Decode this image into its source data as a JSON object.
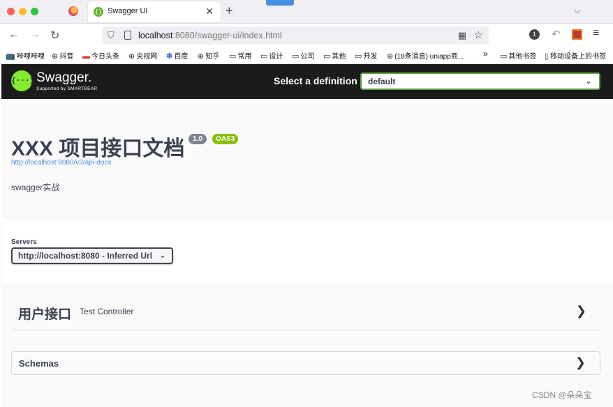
{
  "browser": {
    "tab_title": "Swagger UI",
    "tab_close": "✕",
    "new_tab": "+",
    "tab_list": "⌵",
    "url_host": "localhost",
    "url_path": ":8080/swagger-ui/index.html",
    "nav": {
      "back": "←",
      "forward": "→",
      "reload": "↻"
    },
    "badge_count": "1",
    "menu": "≡",
    "bookmarks": [
      {
        "icon": "tv-icon",
        "label": "哔哩哔哩"
      },
      {
        "icon": "globe-icon",
        "label": "抖音"
      },
      {
        "icon": "news-icon",
        "label": "今日头条"
      },
      {
        "icon": "globe-icon",
        "label": "央视网"
      },
      {
        "icon": "paw-icon",
        "label": "百度"
      },
      {
        "icon": "globe-icon",
        "label": "知乎"
      },
      {
        "icon": "folder-icon",
        "label": "常用"
      },
      {
        "icon": "folder-icon",
        "label": "设计"
      },
      {
        "icon": "folder-icon",
        "label": "公司"
      },
      {
        "icon": "folder-icon",
        "label": "其他"
      },
      {
        "icon": "folder-icon",
        "label": "开发"
      },
      {
        "icon": "globe-icon",
        "label": "(18条消息) uniapp商..."
      }
    ],
    "bookmarks_overflow": "»",
    "bookmarks_other": "其他书签",
    "bookmarks_mobile": "移动设备上的书签"
  },
  "swagger": {
    "logo_mark": "{···}",
    "logo_name": "Swagger.",
    "logo_sub": "Supported by SMARTBEAR",
    "select_label": "Select a definition",
    "select_value": "default"
  },
  "info": {
    "title": "XXX 项目接口文档",
    "version": "1.0",
    "oas": "OAS3",
    "docs_url": "http://localhost:8080/v3/api-docs",
    "description": "swagger实战"
  },
  "servers": {
    "label": "Servers",
    "selected": "http://localhost:8080 - Inferred Url"
  },
  "tags": [
    {
      "name": "用户接口",
      "description": "Test Controller"
    }
  ],
  "schemas": {
    "title": "Schemas"
  },
  "watermark": "CSDN @朵朵宝"
}
